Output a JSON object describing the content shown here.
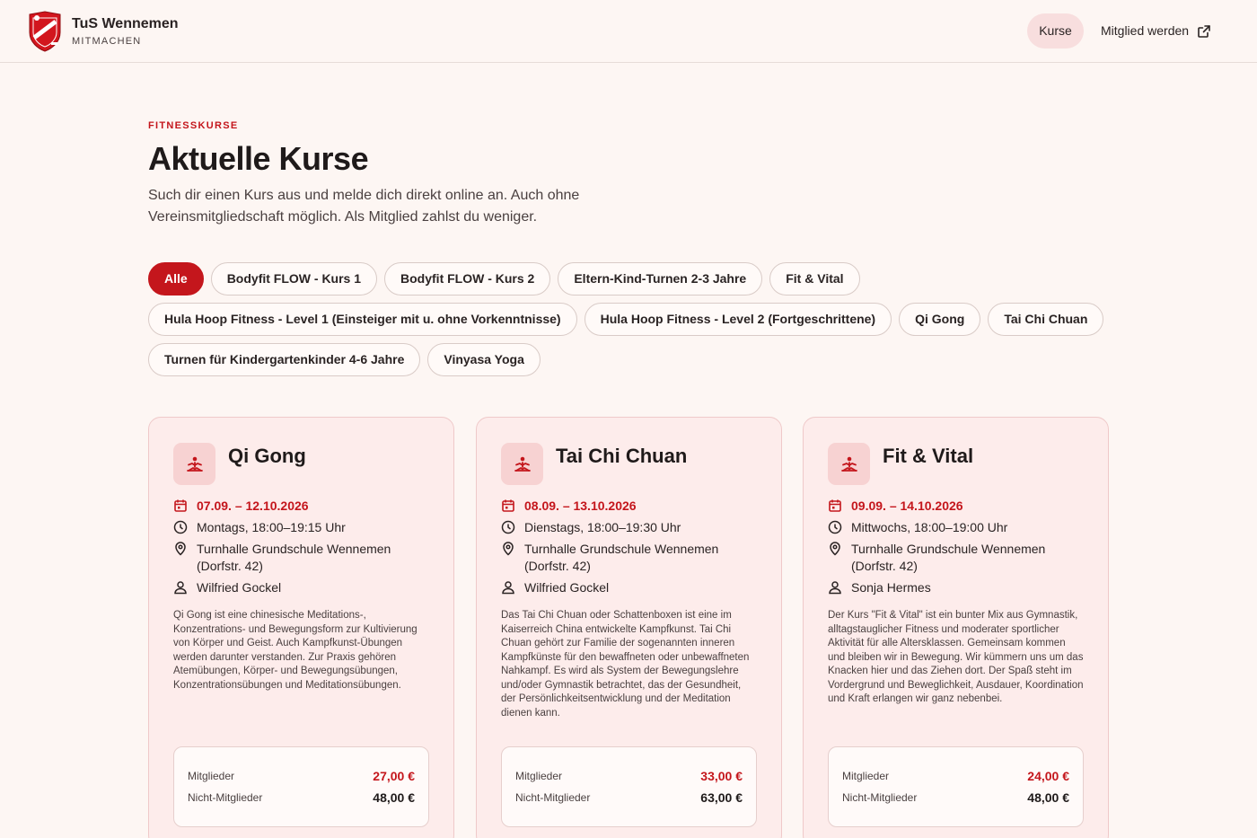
{
  "header": {
    "brand_name": "TuS Wennemen",
    "brand_sub": "MITMACHEN",
    "logo_icon": "club-crest-icon",
    "nav": {
      "kurse": "Kurse",
      "member": "Mitglied werden"
    }
  },
  "hero": {
    "eyebrow": "FITNESSKURSE",
    "title": "Aktuelle Kurse",
    "intro": "Such dir einen Kurs aus und melde dich direkt online an. Auch ohne Vereinsmitgliedschaft möglich. Als Mitglied zahlst du weniger."
  },
  "filters": [
    "Alle",
    "Bodyfit FLOW - Kurs 1",
    "Bodyfit FLOW - Kurs 2",
    "Eltern-Kind-Turnen 2-3 Jahre",
    "Fit & Vital",
    "Hula Hoop Fitness - Level 1 (Einsteiger mit u. ohne Vorkenntnisse)",
    "Hula Hoop Fitness - Level 2 (Fortgeschrittene)",
    "Qi Gong",
    "Tai Chi Chuan",
    "Turnen für Kindergartenkinder 4-6 Jahre",
    "Vinyasa Yoga"
  ],
  "active_filter": "Alle",
  "colors": {
    "accent": "#c4161c",
    "background": "#fdf6f3",
    "card": "#fdeceb"
  },
  "cards": [
    {
      "title": "Qi Gong",
      "dates": "07.09. – 12.10.2026",
      "time": "Montags, 18:00–19:15 Uhr",
      "location": "Turnhalle Grundschule Wennemen (Dorfstr. 42)",
      "trainer": "Wilfried Gockel",
      "description": "Qi Gong ist eine chinesische Meditations-, Konzentrations- und Bewegungsform zur Kultivierung von Körper und Geist. Auch Kampfkunst-Übungen werden darunter verstanden. Zur Praxis gehören Atemübungen, Körper- und Bewegungsübungen, Konzentrationsübungen und Meditationsübungen.",
      "member_label": "Mitglieder",
      "member_price": "27,00 €",
      "nonmember_label": "Nicht-Mitglieder",
      "nonmember_price": "48,00 €"
    },
    {
      "title": "Tai Chi Chuan",
      "dates": "08.09. – 13.10.2026",
      "time": "Dienstags, 18:00–19:30 Uhr",
      "location": "Turnhalle Grundschule Wennemen (Dorfstr. 42)",
      "trainer": "Wilfried Gockel",
      "description": "Das Tai Chi Chuan oder Schattenboxen ist eine im Kaiserreich China entwickelte Kampfkunst. Tai Chi Chuan gehört zur Familie der sogenannten inneren Kampfkünste für den bewaffneten oder unbewaffneten Nahkampf. Es wird als System der Bewegungslehre und/oder Gymnastik betrachtet, das der Gesundheit, der Persönlichkeitsentwicklung und der Meditation dienen kann.",
      "member_label": "Mitglieder",
      "member_price": "33,00 €",
      "nonmember_label": "Nicht-Mitglieder",
      "nonmember_price": "63,00 €"
    },
    {
      "title": "Fit & Vital",
      "dates": "09.09. – 14.10.2026",
      "time": "Mittwochs, 18:00–19:00 Uhr",
      "location": "Turnhalle Grundschule Wennemen (Dorfstr. 42)",
      "trainer": "Sonja Hermes",
      "description": "Der Kurs \"Fit & Vital\" ist ein bunter Mix aus Gymnastik, alltagstauglicher Fitness und moderater sportlicher Aktivität für alle Altersklassen. Gemeinsam kommen und bleiben wir in Bewegung. Wir kümmern uns um das Knacken hier und das Ziehen dort. Der Spaß steht im Vordergrund und Beweglichkeit, Ausdauer, Koordination und Kraft erlangen wir ganz nebenbei.",
      "member_label": "Mitglieder",
      "member_price": "24,00 €",
      "nonmember_label": "Nicht-Mitglieder",
      "nonmember_price": "48,00 €"
    }
  ]
}
